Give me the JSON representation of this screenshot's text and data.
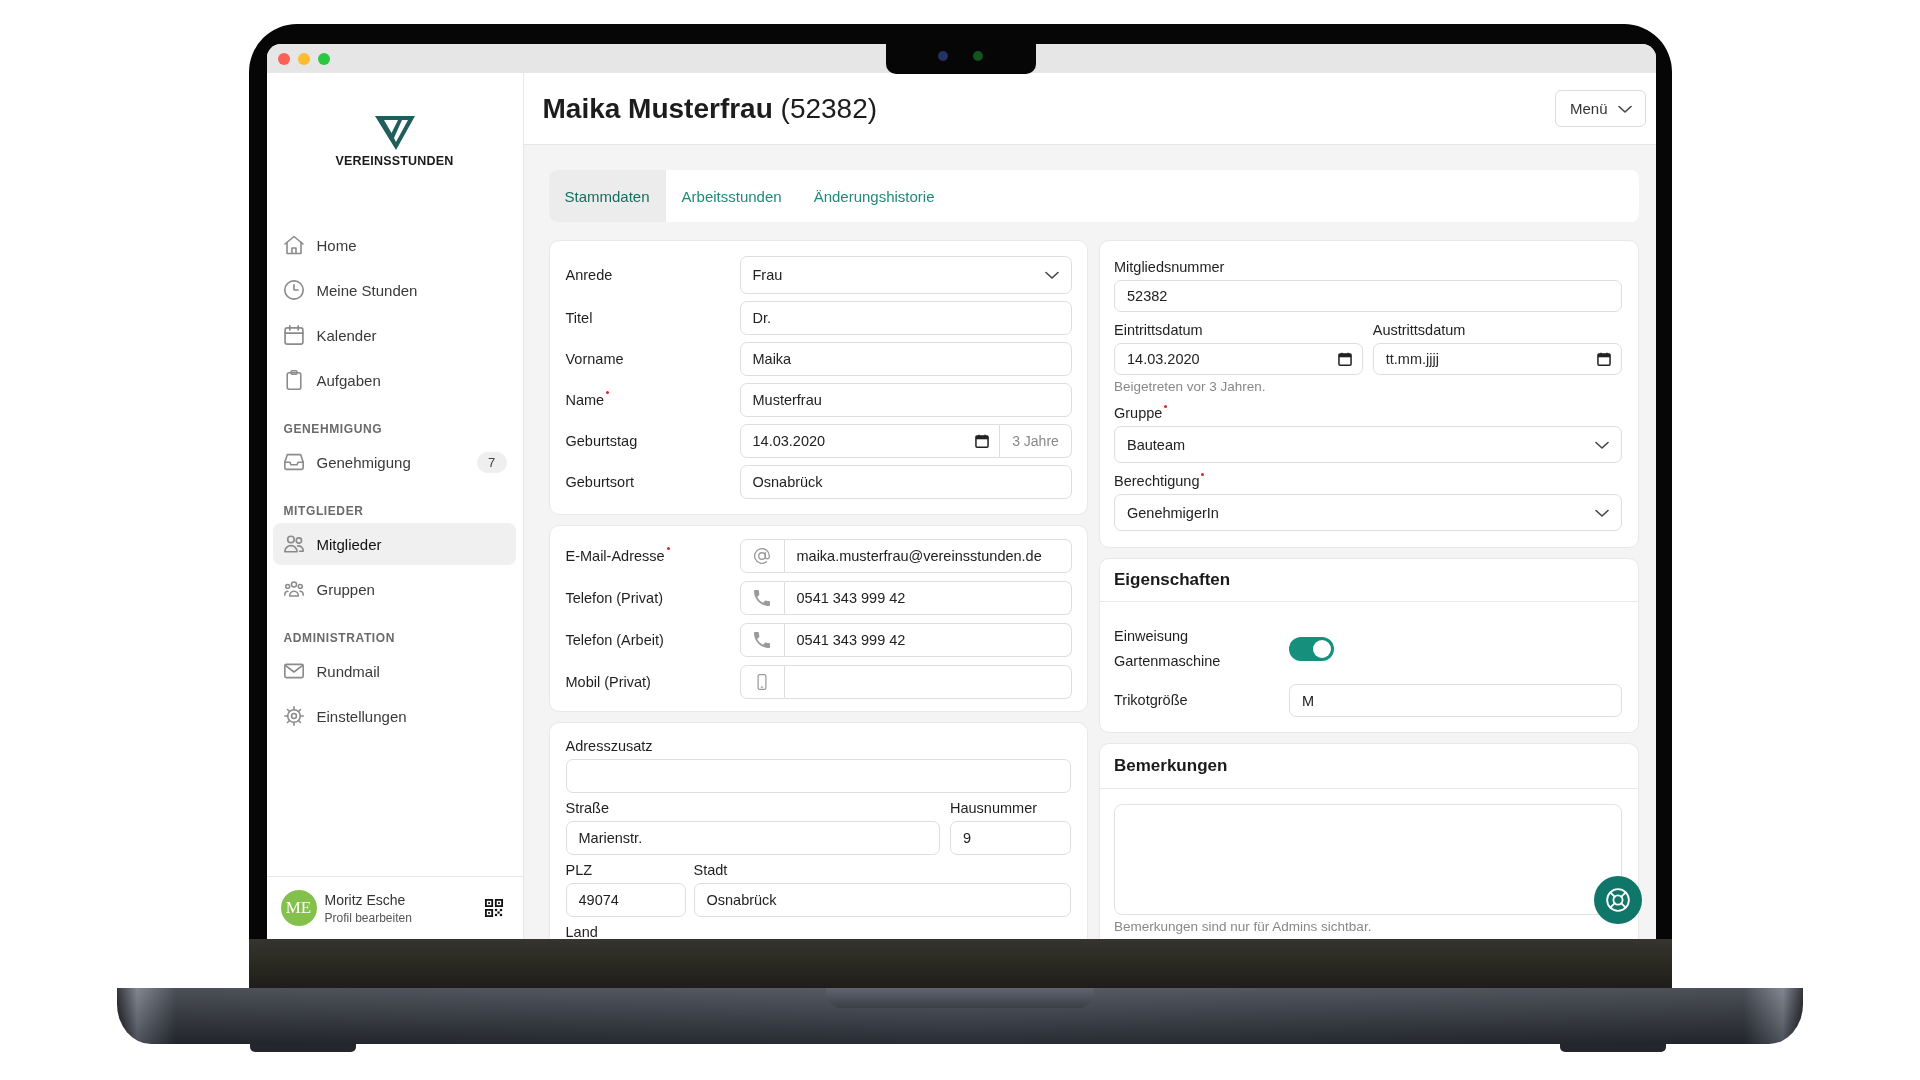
{
  "sidebar": {
    "logo_text": "VEREINSSTUNDEN",
    "sections": [
      {
        "items": [
          {
            "label": "Home",
            "selected": false
          },
          {
            "label": "Meine Stunden",
            "selected": false
          },
          {
            "label": "Kalender",
            "selected": false
          },
          {
            "label": "Aufgaben",
            "selected": false
          }
        ]
      },
      {
        "heading": "GENEHMIGUNG",
        "items": [
          {
            "label": "Genehmigung",
            "badge": "7",
            "selected": false
          }
        ]
      },
      {
        "heading": "MITGLIEDER",
        "items": [
          {
            "label": "Mitglieder",
            "selected": true
          },
          {
            "label": "Gruppen",
            "selected": false
          }
        ]
      },
      {
        "heading": "ADMINISTRATION",
        "items": [
          {
            "label": "Rundmail",
            "selected": false
          },
          {
            "label": "Einstellungen",
            "selected": false
          }
        ]
      }
    ],
    "user": {
      "initials": "ME",
      "name": "Moritz Esche",
      "link": "Profil bearbeiten"
    }
  },
  "header": {
    "title": "**Maika Musterfrau** (52382)",
    "menu_button": "Menü"
  },
  "tabs": [
    {
      "label": "Stammdaten",
      "selected": true
    },
    {
      "label": "Arbeitsstunden",
      "selected": false
    },
    {
      "label": "Änderungshistorie",
      "selected": false
    }
  ],
  "personal": {
    "fields": [
      {
        "kind": "select",
        "label": "Anrede",
        "value": "Frau",
        "required": false
      },
      {
        "kind": "text",
        "label": "Titel",
        "value": "Dr.",
        "required": false
      },
      {
        "kind": "text",
        "label": "Vorname",
        "value": "Maika",
        "required": false
      },
      {
        "kind": "text",
        "label": "Name",
        "value": "Musterfrau",
        "required": true
      },
      {
        "kind": "date",
        "label": "Geburtstag",
        "value": "14.03.2020",
        "addon": "3 Jahre",
        "required": false
      },
      {
        "kind": "text",
        "label": "Geburtsort",
        "value": "Osnabrück",
        "required": false
      }
    ]
  },
  "contact": {
    "fields": [
      {
        "kind": "email",
        "label": "E-Mail-Adresse",
        "value": "maika.musterfrau@vereinsstunden.de",
        "required": true
      },
      {
        "kind": "phone",
        "label": "Telefon (Privat)",
        "value": "0541 343 999 42",
        "required": false
      },
      {
        "kind": "phone",
        "label": "Telefon (Arbeit)",
        "value": "0541 343 999 42",
        "required": false
      },
      {
        "kind": "mobile",
        "label": "Mobil (Privat)",
        "required": false
      }
    ]
  },
  "address": {
    "rows": [
      [
        {
          "kind": "text",
          "label": "Adresszusatz",
          "required": false
        }
      ],
      [
        {
          "kind": "text",
          "label": "Straße",
          "value": "Marienstr.",
          "required": false
        },
        {
          "kind": "text",
          "label": "Hausnummer",
          "value": "9",
          "required": false
        }
      ],
      [
        {
          "kind": "text",
          "label": "PLZ",
          "value": "49074",
          "required": false
        },
        {
          "kind": "text",
          "label": "Stadt",
          "value": "Osnabrück",
          "required": false
        }
      ],
      [
        {
          "kind": "label",
          "label": "Land",
          "required": false
        }
      ]
    ]
  },
  "membership": {
    "rows": [
      [
        {
          "kind": "text",
          "label": "Mitgliedsnummer",
          "value": "52382",
          "required": false
        }
      ],
      [
        {
          "kind": "date",
          "label": "Eintrittsdatum",
          "value": "14.03.2020",
          "hint": "Beigetreten vor 3 Jahren.",
          "required": false
        },
        {
          "kind": "date",
          "label": "Austrittsdatum",
          "placeholder": "tt.mm.jjjj",
          "required": false
        }
      ],
      [
        {
          "kind": "select",
          "label": "Gruppe",
          "value": "Bauteam",
          "required": true
        }
      ],
      [
        {
          "kind": "select",
          "label": "Berechtigung",
          "value": "GenehmigerIn",
          "required": true
        }
      ]
    ]
  },
  "properties": {
    "title": "Eigenschaften",
    "fields": [
      {
        "kind": "toggle",
        "label": "Einweisung Gartenmaschine",
        "on": true
      },
      {
        "kind": "text",
        "label": "Trikotgröße",
        "value": "M"
      }
    ]
  },
  "remarks": {
    "title": "Bemerkungen",
    "hint": "Bemerkungen sind nur für Admins sichtbar."
  }
}
